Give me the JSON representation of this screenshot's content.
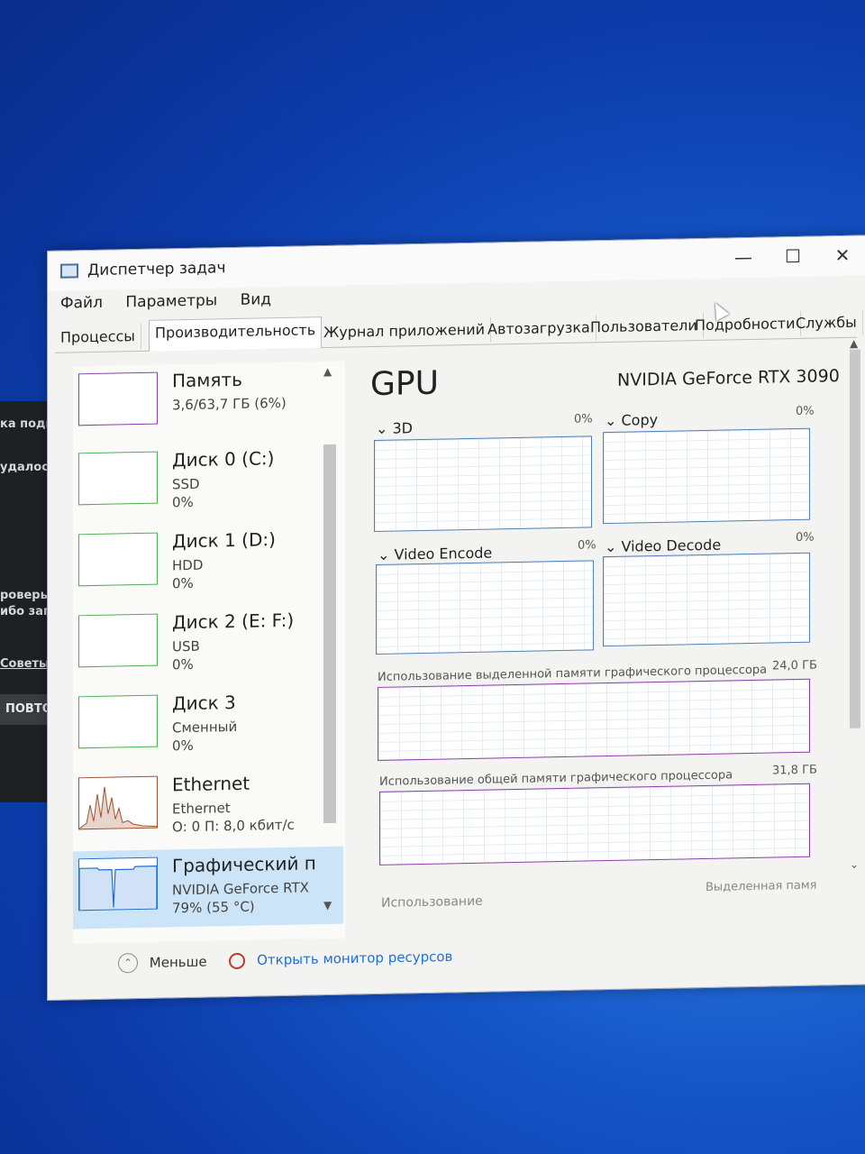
{
  "background": {
    "lines": [
      "ка подкл",
      "удалось",
      "роверьте п",
      "ибо запуст",
      "Советы по п"
    ],
    "button": "ПОВТОРИТЬ"
  },
  "window": {
    "title": "Диспетчер задач",
    "controls": {
      "minimize": "—",
      "maximize": "☐",
      "close": "✕"
    }
  },
  "menu": [
    "Файл",
    "Параметры",
    "Вид"
  ],
  "tabs": [
    "Процессы",
    "Производительность",
    "Журнал приложений",
    "Автозагрузка",
    "Пользователи",
    "Подробности",
    "Службы"
  ],
  "active_tab": "Производительность",
  "sidebar": {
    "items": [
      {
        "name": "Память",
        "sub1": "3,6/63,7 ГБ (6%)",
        "sub2": "",
        "color": "#8b3fa8",
        "selected": false
      },
      {
        "name": "Диск 0 (C:)",
        "sub1": "SSD",
        "sub2": "0%",
        "color": "#4caf50",
        "selected": false
      },
      {
        "name": "Диск 1 (D:)",
        "sub1": "HDD",
        "sub2": "0%",
        "color": "#4caf50",
        "selected": false
      },
      {
        "name": "Диск 2 (E: F:)",
        "sub1": "USB",
        "sub2": "0%",
        "color": "#4caf50",
        "selected": false
      },
      {
        "name": "Диск 3",
        "sub1": "Сменный",
        "sub2": "0%",
        "color": "#4caf50",
        "selected": false
      },
      {
        "name": "Ethernet",
        "sub1": "Ethernet",
        "sub2": "О: 0 П: 8,0 кбит/с",
        "color": "#a0522d",
        "selected": false
      },
      {
        "name": "Графический п",
        "sub1": "NVIDIA GeForce RTX",
        "sub2": "79% (55 °C)",
        "color": "#1f6fd0",
        "selected": true
      }
    ]
  },
  "gpu": {
    "title": "GPU",
    "name": "NVIDIA GeForce RTX 3090",
    "engines": [
      {
        "label": "3D",
        "percent": "0%"
      },
      {
        "label": "Copy",
        "percent": "0%"
      },
      {
        "label": "Video Encode",
        "percent": "0%"
      },
      {
        "label": "Video Decode",
        "percent": "0%"
      }
    ],
    "dedicated_label": "Использование выделенной памяти графического процессора",
    "dedicated_max": "24,0 ГБ",
    "shared_label": "Использование общей памяти графического процессора",
    "shared_max": "31,8 ГБ",
    "bottom_left": "Использование",
    "bottom_right": "Выделенная памя"
  },
  "footer": {
    "less": "Меньше",
    "monitor": "Открыть монитор ресурсов"
  }
}
